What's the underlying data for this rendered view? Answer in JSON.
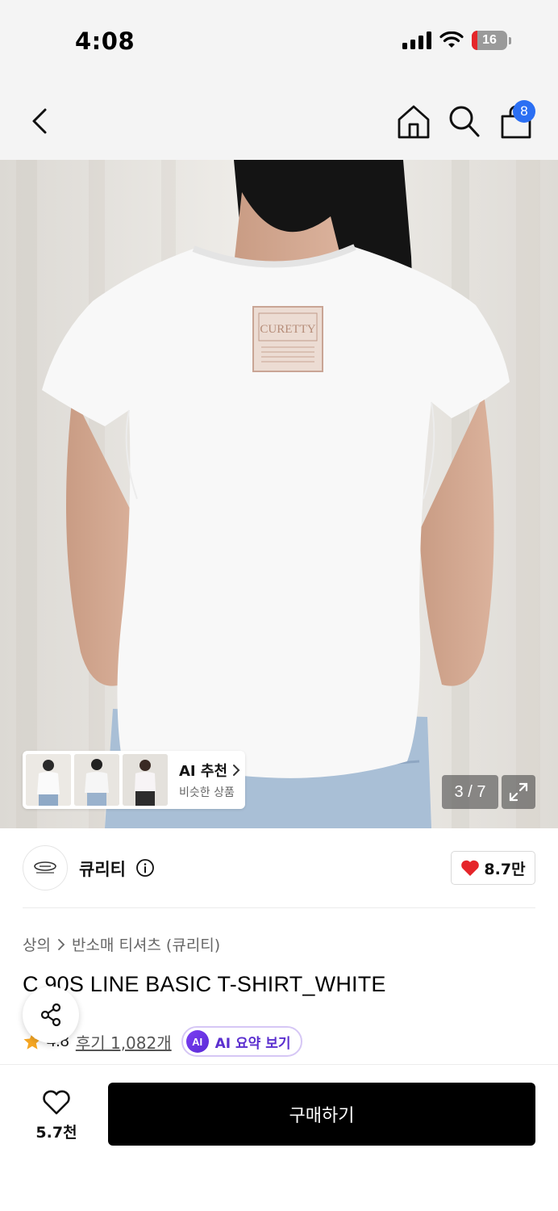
{
  "status_bar": {
    "time": "4:08",
    "battery": "16"
  },
  "nav": {
    "cart_badge": "8",
    "icons": [
      "back-icon",
      "home-icon",
      "search-icon",
      "cart-icon"
    ]
  },
  "hero": {
    "ai_recommend": {
      "title": "AI 추천",
      "subtitle": "비슷한 상품"
    },
    "counter": "3 / 7"
  },
  "brand": {
    "name": "큐리티",
    "likes": "8.7만"
  },
  "product": {
    "breadcrumb": {
      "category": "상의",
      "subcategory": "반소매 티셔츠 (큐리티)"
    },
    "title": "C 90S LINE BASIC T-SHIRT_WHITE",
    "rating": "4.8",
    "reviews": "후기 1,082개",
    "ai_badge": "AI",
    "ai_summary": "AI 요약 보기"
  },
  "bottom": {
    "wish_count": "5.7천",
    "buy_label": "구매하기"
  },
  "colors": {
    "accent_blue": "#2b6ff3",
    "heart_red": "#e5252a",
    "ai_purple": "#5b2fcf",
    "buy_black": "#000000"
  }
}
